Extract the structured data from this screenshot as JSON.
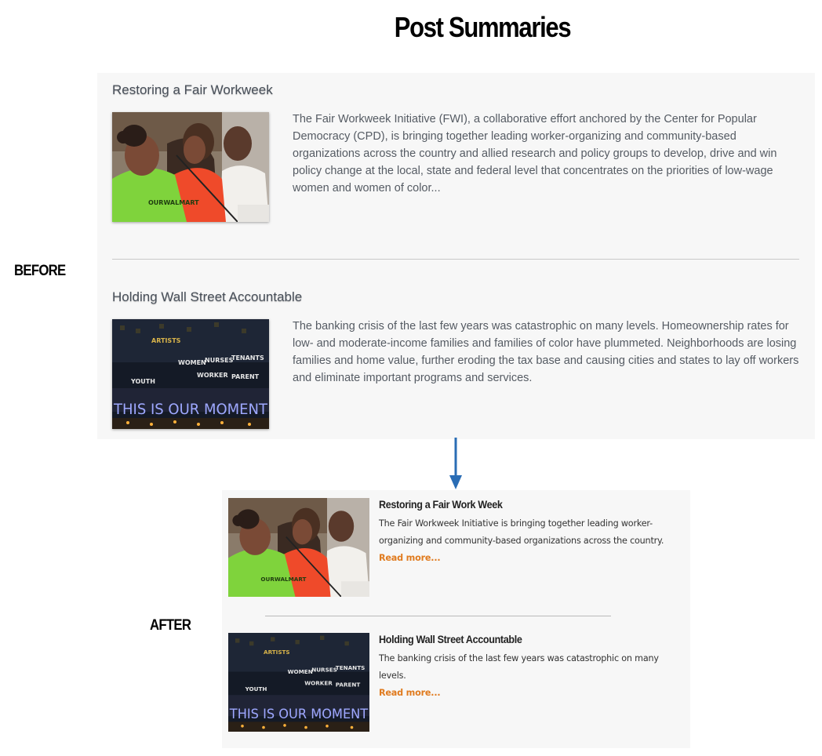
{
  "page_title": "Post Summaries",
  "labels": {
    "before": "BEFORE",
    "after": "AFTER"
  },
  "before": {
    "posts": [
      {
        "title": "Restoring a Fair Workweek",
        "excerpt": "The Fair Workweek Initiative (FWI), a collaborative effort anchored by the Center for Popular Democracy (CPD), is bringing together leading worker-organizing and community-based organizations across the country and allied research and policy groups to develop, drive and win policy change at the local, state and federal level that concentrates on the priorities of low-wage women and women of color..."
      },
      {
        "title": "Holding Wall Street Accountable",
        "excerpt": "The banking crisis of the last few years was catastrophic on many levels. Homeownership rates for low- and moderate-income families and families of color have plummeted. Neighborhoods are losing families and home value, further eroding the tax base and causing cities and states to lay off workers and eliminate important programs and services."
      }
    ]
  },
  "after": {
    "posts": [
      {
        "title": "Restoring a Fair Work Week",
        "excerpt": "The Fair Workweek Initiative is bringing together leading worker-organizing and community-based organizations across the country.",
        "read_more": "Read more..."
      },
      {
        "title": "Holding Wall Street Accountable",
        "excerpt": "The banking crisis of the last few years was catastrophic on many levels.",
        "read_more": "Read more..."
      }
    ]
  },
  "photo_text": {
    "shirt": "OURWALMART",
    "protest_signs": [
      "ARTISTS",
      "WOMEN",
      "NURSES",
      "TENANTS",
      "WORKER",
      "PARENT",
      "YOUTH"
    ],
    "light_banner": "THIS IS OUR MOMENT"
  },
  "colors": {
    "read_more": "#e07b1f",
    "arrow": "#2a6db5",
    "panel_bg": "#f7f7f7"
  }
}
